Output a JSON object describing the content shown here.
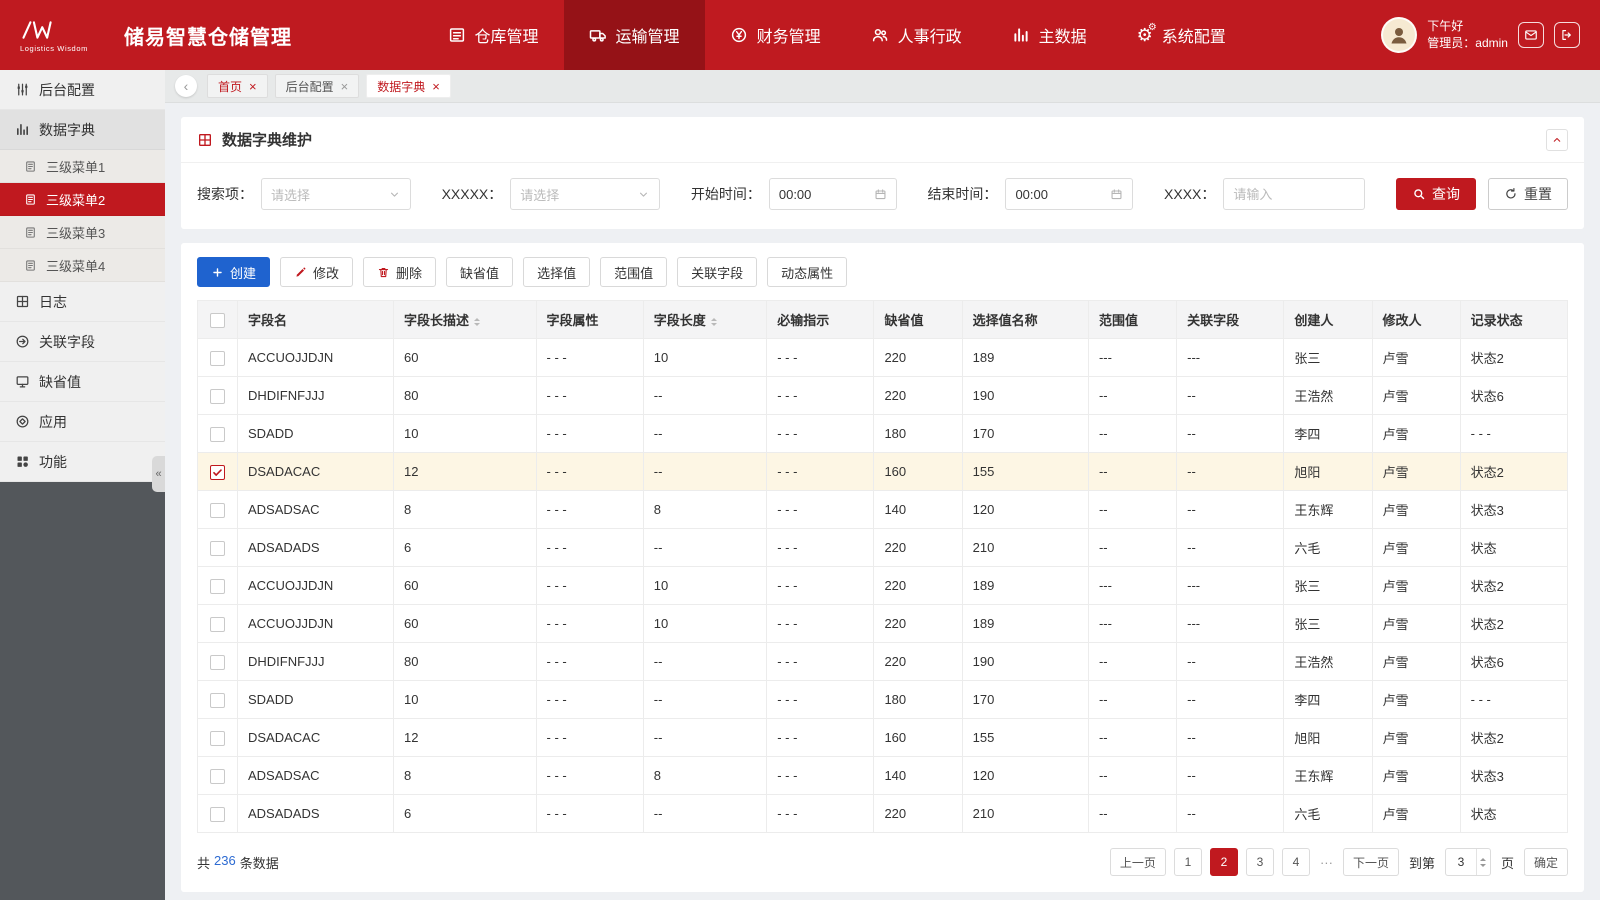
{
  "app": {
    "title": "储易智慧仓储管理",
    "logo_subtitle": "Logistics Wisdom",
    "greeting": "下午好",
    "user": "管理员：admin",
    "accent_color": "#c0191f",
    "primary_blue": "#1f63cf"
  },
  "nav": {
    "items": [
      {
        "name": "warehouse-mgmt",
        "label": "仓库管理",
        "icon": "warehouse",
        "active": false
      },
      {
        "name": "transport-mgmt",
        "label": "运输管理",
        "icon": "truck",
        "active": true
      },
      {
        "name": "finance-mgmt",
        "label": "财务管理",
        "icon": "yen",
        "active": false
      },
      {
        "name": "hr-admin",
        "label": "人事行政",
        "icon": "people",
        "active": false
      },
      {
        "name": "master-data",
        "label": "主数据",
        "icon": "bars",
        "active": false
      },
      {
        "name": "system-config",
        "label": "系统配置",
        "icon": "gears",
        "active": false
      }
    ]
  },
  "sidebar": {
    "items": [
      {
        "name": "backend-config",
        "label": "后台配置",
        "icon": "sliders",
        "type": "group",
        "open": false,
        "active": false
      },
      {
        "name": "data-dictionary",
        "label": "数据字典",
        "icon": "bars",
        "type": "group",
        "open": true,
        "active": false
      },
      {
        "name": "submenu-1",
        "label": "三级菜单1",
        "icon": "doc",
        "type": "sub",
        "active": false
      },
      {
        "name": "submenu-2",
        "label": "三级菜单2",
        "icon": "doc",
        "type": "sub",
        "active": true
      },
      {
        "name": "submenu-3",
        "label": "三级菜单3",
        "icon": "doc",
        "type": "sub",
        "active": false
      },
      {
        "name": "submenu-4",
        "label": "三级菜单4",
        "icon": "doc",
        "type": "sub",
        "active": false
      },
      {
        "name": "logs",
        "label": "日志",
        "icon": "grid",
        "type": "group",
        "open": false,
        "active": false
      },
      {
        "name": "related-fields",
        "label": "关联字段",
        "icon": "link",
        "type": "group",
        "open": false,
        "active": false
      },
      {
        "name": "default-values",
        "label": "缺省值",
        "icon": "monitor",
        "type": "group",
        "open": false,
        "active": false
      },
      {
        "name": "application",
        "label": "应用",
        "icon": "app",
        "type": "group",
        "open": false,
        "active": false
      },
      {
        "name": "functions",
        "label": "功能",
        "icon": "dots",
        "type": "group",
        "open": false,
        "active": false
      }
    ],
    "collapse_glyph": "«"
  },
  "tabs": [
    {
      "name": "home",
      "label": "首页",
      "style": "red",
      "active": false
    },
    {
      "name": "backend-config",
      "label": "后台配置",
      "style": "",
      "active": false
    },
    {
      "name": "data-dictionary",
      "label": "数据字典",
      "style": "",
      "active": true
    }
  ],
  "panel": {
    "title": "数据字典维护"
  },
  "filters": [
    {
      "name": "search-term",
      "label": "搜索项：",
      "type": "select",
      "placeholder": "请选择"
    },
    {
      "name": "xxxxx",
      "label": "XXXXX：",
      "type": "select",
      "placeholder": "请选择"
    },
    {
      "name": "start-time",
      "label": "开始时间：",
      "type": "time",
      "value": "00:00"
    },
    {
      "name": "end-time",
      "label": "结束时间：",
      "type": "time",
      "value": "00:00"
    },
    {
      "name": "xxxx",
      "label": "XXXX：",
      "type": "text",
      "placeholder": "请输入"
    }
  ],
  "filter_buttons": {
    "query": "查询",
    "reset": "重置"
  },
  "actions": [
    {
      "name": "create",
      "label": "创建",
      "icon": "plus",
      "kind": "primary",
      "icon_color": ""
    },
    {
      "name": "edit",
      "label": "修改",
      "icon": "pencil",
      "kind": "",
      "icon_color": "red"
    },
    {
      "name": "delete",
      "label": "删除",
      "icon": "trash",
      "kind": "",
      "icon_color": "red"
    },
    {
      "name": "default-value",
      "label": "缺省值",
      "icon": "",
      "kind": "",
      "icon_color": ""
    },
    {
      "name": "select-value",
      "label": "选择值",
      "icon": "",
      "kind": "",
      "icon_color": ""
    },
    {
      "name": "range-value",
      "label": "范围值",
      "icon": "",
      "kind": "",
      "icon_color": ""
    },
    {
      "name": "related-field",
      "label": "关联字段",
      "icon": "",
      "kind": "",
      "icon_color": ""
    },
    {
      "name": "dynamic-attr",
      "label": "动态属性",
      "icon": "",
      "kind": "",
      "icon_color": ""
    }
  ],
  "table": {
    "columns": [
      {
        "label": "字段名",
        "sortable": false
      },
      {
        "label": "字段长描述",
        "sortable": true
      },
      {
        "label": "字段属性",
        "sortable": false
      },
      {
        "label": "字段长度",
        "sortable": true
      },
      {
        "label": "必输指示",
        "sortable": false
      },
      {
        "label": "缺省值",
        "sortable": false
      },
      {
        "label": "选择值名称",
        "sortable": false
      },
      {
        "label": "范围值",
        "sortable": false
      },
      {
        "label": "关联字段",
        "sortable": false
      },
      {
        "label": "创建人",
        "sortable": false
      },
      {
        "label": "修改人",
        "sortable": false
      },
      {
        "label": "记录状态",
        "sortable": false
      }
    ],
    "rows": [
      {
        "checked": false,
        "cells": [
          "ACCUOJJDJN",
          "60",
          "- - -",
          "10",
          "- - -",
          "220",
          "189",
          "---",
          "---",
          "张三",
          "卢雪",
          "状态2"
        ]
      },
      {
        "checked": false,
        "cells": [
          "DHDIFNFJJJ",
          "80",
          "- - -",
          "--",
          "- - -",
          "220",
          "190",
          "--",
          "--",
          "王浩然",
          "卢雪",
          "状态6"
        ]
      },
      {
        "checked": false,
        "cells": [
          "SDADD",
          "10",
          "- - -",
          "--",
          "- - -",
          "180",
          "170",
          "--",
          "--",
          "李四",
          "卢雪",
          "- - -"
        ]
      },
      {
        "checked": true,
        "cells": [
          "DSADACAC",
          "12",
          "- - -",
          "--",
          "- - -",
          "160",
          "155",
          "--",
          "--",
          "旭阳",
          "卢雪",
          "状态2"
        ]
      },
      {
        "checked": false,
        "cells": [
          "ADSADSAC",
          "8",
          "- - -",
          "8",
          "- - -",
          "140",
          "120",
          "--",
          "--",
          "王东辉",
          "卢雪",
          "状态3"
        ]
      },
      {
        "checked": false,
        "cells": [
          "ADSADADS",
          "6",
          "- - -",
          "--",
          "- - -",
          "220",
          "210",
          "--",
          "--",
          "六毛",
          "卢雪",
          "状态"
        ]
      },
      {
        "checked": false,
        "cells": [
          "ACCUOJJDJN",
          "60",
          "- - -",
          "10",
          "- - -",
          "220",
          "189",
          "---",
          "---",
          "张三",
          "卢雪",
          "状态2"
        ]
      },
      {
        "checked": false,
        "cells": [
          "ACCUOJJDJN",
          "60",
          "- - -",
          "10",
          "- - -",
          "220",
          "189",
          "---",
          "---",
          "张三",
          "卢雪",
          "状态2"
        ]
      },
      {
        "checked": false,
        "cells": [
          "DHDIFNFJJJ",
          "80",
          "- - -",
          "--",
          "- - -",
          "220",
          "190",
          "--",
          "--",
          "王浩然",
          "卢雪",
          "状态6"
        ]
      },
      {
        "checked": false,
        "cells": [
          "SDADD",
          "10",
          "- - -",
          "--",
          "- - -",
          "180",
          "170",
          "--",
          "--",
          "李四",
          "卢雪",
          "- - -"
        ]
      },
      {
        "checked": false,
        "cells": [
          "DSADACAC",
          "12",
          "- - -",
          "--",
          "- - -",
          "160",
          "155",
          "--",
          "--",
          "旭阳",
          "卢雪",
          "状态2"
        ]
      },
      {
        "checked": false,
        "cells": [
          "ADSADSAC",
          "8",
          "- - -",
          "8",
          "- - -",
          "140",
          "120",
          "--",
          "--",
          "王东辉",
          "卢雪",
          "状态3"
        ]
      },
      {
        "checked": false,
        "cells": [
          "ADSADADS",
          "6",
          "- - -",
          "--",
          "- - -",
          "220",
          "210",
          "--",
          "--",
          "六毛",
          "卢雪",
          "状态"
        ]
      }
    ]
  },
  "pagination": {
    "summary_prefix": "共",
    "summary_count": "236",
    "summary_suffix": "条数据",
    "prev_label": "上一页",
    "next_label": "下一页",
    "pages": [
      "1",
      "2",
      "3",
      "4"
    ],
    "active_page": "2",
    "ellipsis": "···",
    "goto_prefix": "到第",
    "goto_value": "3",
    "goto_suffix": "页",
    "confirm_label": "确定"
  }
}
